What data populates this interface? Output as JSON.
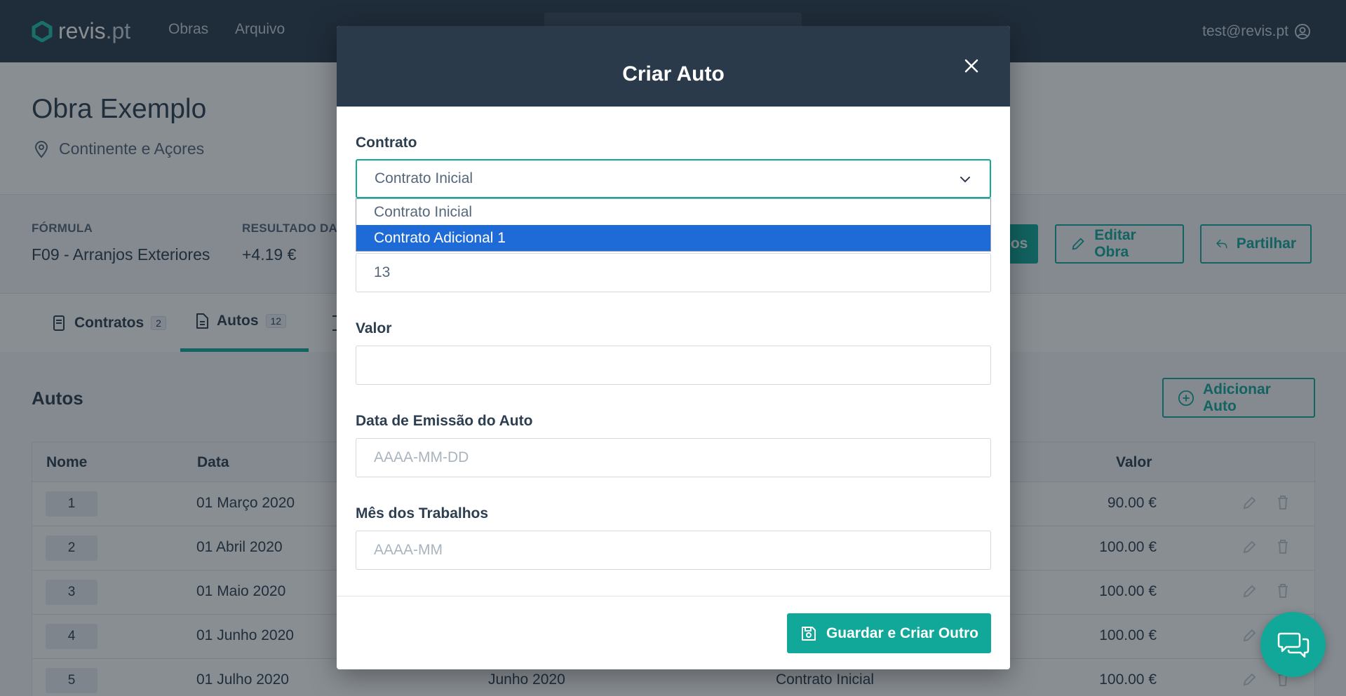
{
  "topbar": {
    "logo_main": "revis",
    "logo_suffix": ".pt",
    "nav": [
      "Obras",
      "Arquivo"
    ],
    "user_email": "test@revis.pt"
  },
  "obra": {
    "title": "Obra Exemplo",
    "location": "Continente e Açores"
  },
  "info": {
    "formula_label": "FÓRMULA",
    "formula_value": "F09 - Arranjos Exteriores",
    "resultado_label": "RESULTADO DA",
    "resultado_value": "+4.19 €",
    "solid_btn_partial": "ios",
    "edit_label": "Editar Obra",
    "share_label": "Partilhar"
  },
  "tabs": [
    {
      "label": "Contratos",
      "count": "2"
    },
    {
      "label": "Autos",
      "count": "12"
    }
  ],
  "autos": {
    "title": "Autos",
    "add_label": "Adicionar Auto",
    "columns": {
      "nome": "Nome",
      "data": "Data",
      "valor": "Valor"
    },
    "rows": [
      {
        "num": "1",
        "data": "01 Março 2020",
        "mes": "",
        "contrato": "",
        "valor": "90.00 €"
      },
      {
        "num": "2",
        "data": "01 Abril 2020",
        "mes": "",
        "contrato": "",
        "valor": "100.00 €"
      },
      {
        "num": "3",
        "data": "01 Maio 2020",
        "mes": "",
        "contrato": "",
        "valor": "100.00 €"
      },
      {
        "num": "4",
        "data": "01 Junho 2020",
        "mes": "",
        "contrato": "",
        "valor": "100.00 €"
      },
      {
        "num": "5",
        "data": "01 Julho 2020",
        "mes": "Junho 2020",
        "contrato": "Contrato Inicial",
        "valor": "100.00 €"
      }
    ]
  },
  "modal": {
    "title": "Criar Auto",
    "contrato_label": "Contrato",
    "contrato_value": "Contrato Inicial",
    "options": [
      "Contrato Inicial",
      "Contrato Adicional 1"
    ],
    "numero_value": "13",
    "valor_label": "Valor",
    "valor_value": "",
    "data_label": "Data de Emissão do Auto",
    "data_placeholder": "AAAA-MM-DD",
    "mes_label": "Mês dos Trabalhos",
    "mes_placeholder": "AAAA-MM",
    "save_label": "Guardar e Criar Outro"
  },
  "colors": {
    "accent": "#11a89a",
    "header_dark": "#2a3a4a",
    "selected_option": "#1e6bd8"
  }
}
